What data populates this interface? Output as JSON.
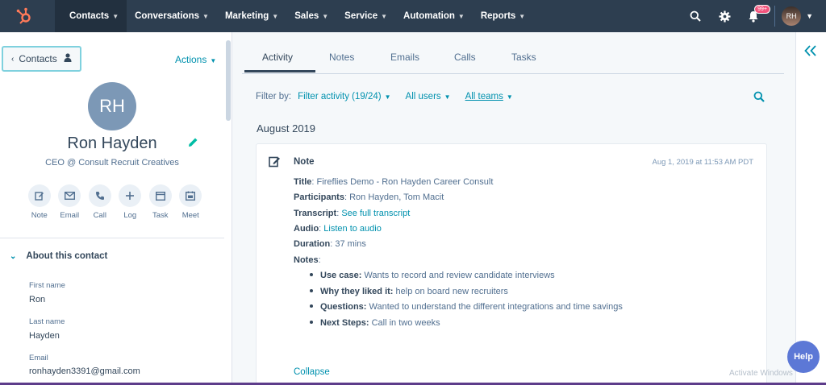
{
  "topnav": {
    "items": [
      {
        "label": "Contacts"
      },
      {
        "label": "Conversations"
      },
      {
        "label": "Marketing"
      },
      {
        "label": "Sales"
      },
      {
        "label": "Service"
      },
      {
        "label": "Automation"
      },
      {
        "label": "Reports"
      }
    ],
    "notification_count": "99+",
    "avatar_initials": "RH"
  },
  "sidebar": {
    "back_label": "Contacts",
    "actions_label": "Actions",
    "avatar_initials": "RH",
    "contact_name": "Ron Hayden",
    "contact_title": "CEO @ Consult Recruit Creatives",
    "quick_actions": [
      {
        "label": "Note",
        "icon": "note-edit-icon"
      },
      {
        "label": "Email",
        "icon": "email-icon"
      },
      {
        "label": "Call",
        "icon": "phone-icon"
      },
      {
        "label": "Log",
        "icon": "plus-icon"
      },
      {
        "label": "Task",
        "icon": "task-icon"
      },
      {
        "label": "Meet",
        "icon": "calendar-icon"
      }
    ],
    "about_heading": "About this contact",
    "properties": [
      {
        "label": "First name",
        "value": "Ron"
      },
      {
        "label": "Last name",
        "value": "Hayden"
      },
      {
        "label": "Email",
        "value": "ronhayden3391@gmail.com"
      }
    ]
  },
  "main": {
    "tabs": [
      {
        "label": "Activity"
      },
      {
        "label": "Notes"
      },
      {
        "label": "Emails"
      },
      {
        "label": "Calls"
      },
      {
        "label": "Tasks"
      }
    ],
    "filter": {
      "label": "Filter by:",
      "activity": "Filter activity (19/24)",
      "users": "All users",
      "teams": "All teams"
    },
    "month_heading": "August 2019",
    "note": {
      "type": "Note",
      "timestamp": "Aug 1, 2019 at 11:53 AM PDT",
      "title_label": "Title",
      "title_value": ": Fireflies Demo - Ron Hayden Career Consult",
      "participants_label": "Participants",
      "participants_value": ": Ron Hayden, Tom Macit",
      "transcript_label": "Transcript",
      "transcript_sep": ": ",
      "transcript_link": "See full transcript",
      "audio_label": "Audio",
      "audio_sep": ": ",
      "audio_link": "Listen to audio",
      "duration_label": "Duration",
      "duration_value": ": 37 mins",
      "notes_label": "Notes",
      "notes_sep": ":",
      "bullets": [
        {
          "label": "Use case:",
          "value": " Wants to record and review candidate interviews"
        },
        {
          "label": "Why they liked it:",
          "value": " help on board new recruiters"
        },
        {
          "label": "Questions:",
          "value": " Wanted to understand the different integrations and time savings"
        },
        {
          "label": "Next Steps:",
          "value": " Call in two weeks"
        }
      ],
      "collapse_label": "Collapse"
    }
  },
  "watermark": "Activate Windows",
  "help_label": "Help",
  "colors": {
    "nav_bg": "#2d3e50",
    "accent": "#0091ae",
    "text": "#33475b",
    "logo": "#ff7a59",
    "help": "#5c78d6"
  }
}
